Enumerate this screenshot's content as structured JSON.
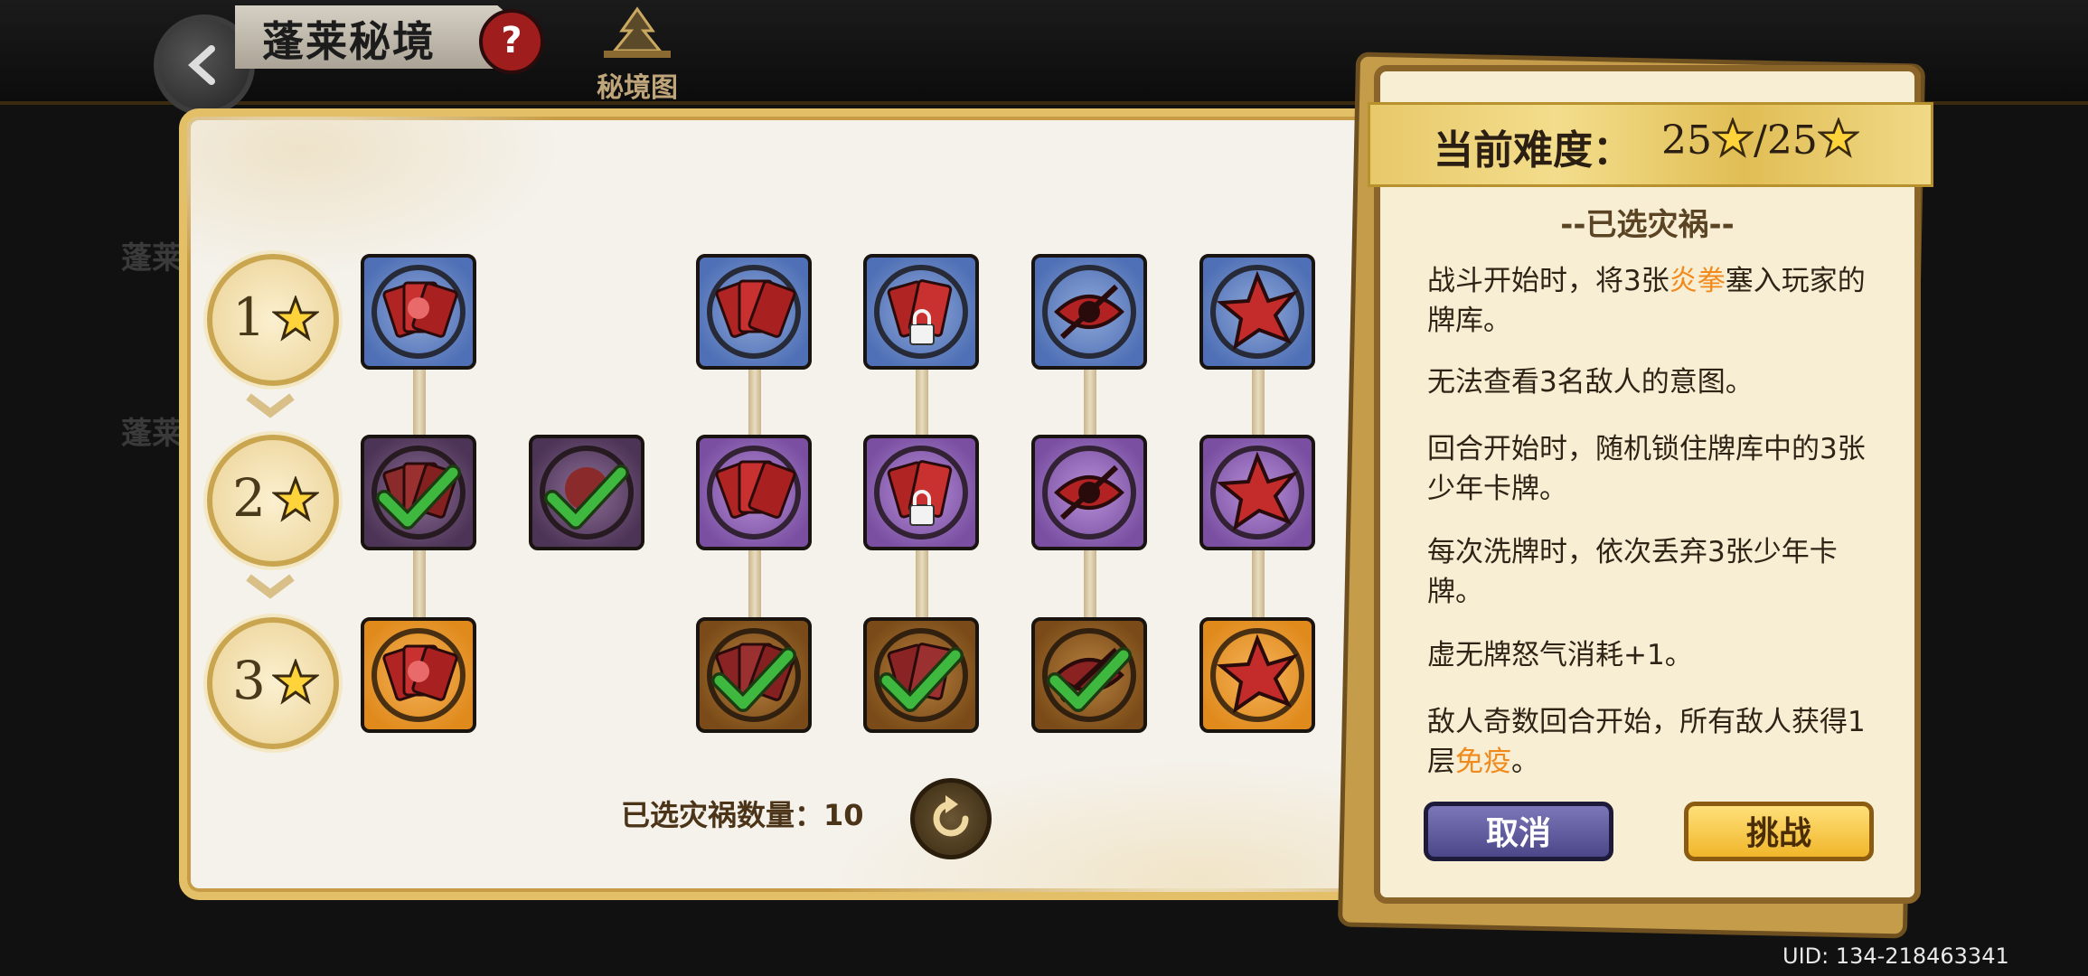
{
  "header": {
    "title": "蓬莱秘境",
    "help_icon": "?",
    "map_label": "秘境图"
  },
  "background": {
    "stub1": "蓬莱",
    "stub2": "蓬莱"
  },
  "grid": {
    "tiers": [
      {
        "label": "1"
      },
      {
        "label": "2"
      },
      {
        "label": "3"
      }
    ],
    "selected_count_label": "已选灾祸数量：10"
  },
  "info": {
    "difficulty_label": "当前难度：",
    "difficulty_value": "25",
    "difficulty_max": "/25",
    "section_title": "--已选灾祸--",
    "descs": [
      {
        "pre": "战斗开始时，将3张",
        "hl": "炎拳",
        "post": "塞入玩家的牌库。"
      },
      {
        "text": "无法查看3名敌人的意图。"
      },
      {
        "text": "回合开始时，随机锁住牌库中的3张少年卡牌。"
      },
      {
        "text": "每次洗牌时，依次丢弃3张少年卡牌。"
      },
      {
        "text": "虚无牌怒气消耗+1。"
      },
      {
        "pre": "敌人奇数回合开始，所有敌人获得1层",
        "hl": "免疫",
        "post": "。"
      }
    ],
    "cancel_label": "取消",
    "challenge_label": "挑战"
  },
  "uid": "UID: 134-218463341",
  "colors": {
    "accent_gold": "#e3c068",
    "highlight": "#f08a1c",
    "check_green": "#3fb83f"
  }
}
